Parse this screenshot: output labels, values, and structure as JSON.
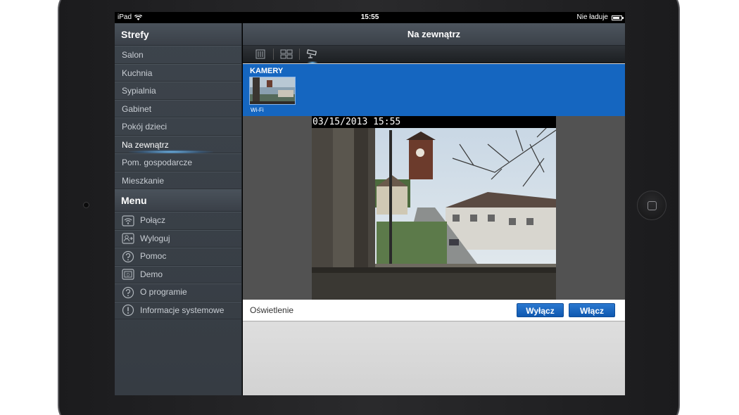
{
  "status_bar": {
    "device": "iPad",
    "time": "15:55",
    "charging": "Nie ładuje"
  },
  "sidebar": {
    "zones_header": "Strefy",
    "zones": [
      {
        "label": "Salon",
        "active": false
      },
      {
        "label": "Kuchnia",
        "active": false
      },
      {
        "label": "Sypialnia",
        "active": false
      },
      {
        "label": "Gabinet",
        "active": false
      },
      {
        "label": "Pokój dzieci",
        "active": false
      },
      {
        "label": "Na zewnątrz",
        "active": true
      },
      {
        "label": "Pom. gospodarcze",
        "active": false
      },
      {
        "label": "Mieszkanie",
        "active": false
      }
    ],
    "menu_header": "Menu",
    "menu": [
      {
        "label": "Połącz",
        "icon": "connect-icon"
      },
      {
        "label": "Wyloguj",
        "icon": "logout-icon"
      },
      {
        "label": "Pomoc",
        "icon": "help-icon"
      },
      {
        "label": "Demo",
        "icon": "demo-icon"
      },
      {
        "label": "O programie",
        "icon": "about-icon"
      },
      {
        "label": "Informacje systemowe",
        "icon": "info-icon"
      }
    ]
  },
  "main": {
    "title": "Na zewnątrz",
    "toolbar": [
      "sliders-icon",
      "grid-icon",
      "camera-icon"
    ],
    "cameras_label": "KAMERY",
    "camera_thumb_label": "Wi-Fi",
    "video_timestamp": "03/15/2013 15:55",
    "control": {
      "label": "Oświetlenie",
      "off_label": "Wyłącz",
      "on_label": "Włącz"
    }
  },
  "colors": {
    "accent": "#1566c0",
    "sidebar": "#3b4148"
  }
}
